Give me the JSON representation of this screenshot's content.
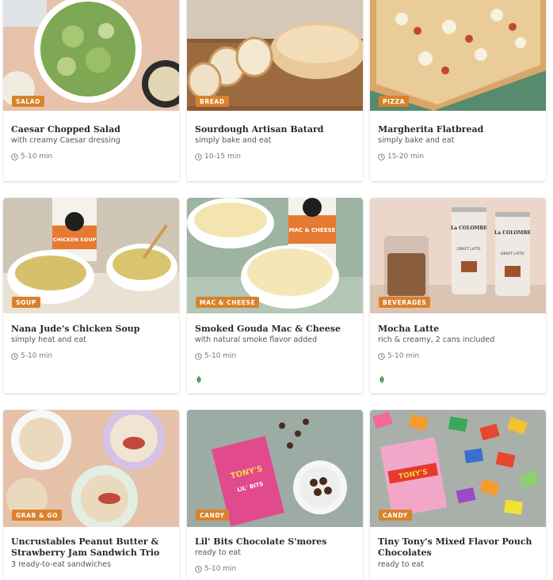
{
  "products": [
    {
      "category": "SALAD",
      "title": "Caesar Chopped Salad",
      "subtitle": "with creamy Caesar dressing",
      "time": "5-10 min"
    },
    {
      "category": "BREAD",
      "title": "Sourdough Artisan Batard",
      "subtitle": "simply bake and eat",
      "time": "10-15 min"
    },
    {
      "category": "PIZZA",
      "title": "Margherita Flatbread",
      "subtitle": "simply bake and eat",
      "time": "15-20 min"
    },
    {
      "category": "SOUP",
      "title": "Nana Jude's Chicken Soup",
      "subtitle": "simply heat and eat",
      "time": "5-10 min"
    },
    {
      "category": "MAC & CHEESE",
      "title": "Smoked Gouda Mac & Cheese",
      "subtitle": "with natural smoke flavor added",
      "time": "5-10 min"
    },
    {
      "category": "BEVERAGES",
      "title": "Mocha Latte",
      "subtitle": "rich & creamy, 2 cans included",
      "time": "5-10 min"
    },
    {
      "category": "GRAB & GO",
      "title": "Uncrustables Peanut Butter & Strawberry Jam Sandwich Trio",
      "subtitle": "3 ready-to-eat sandwiches"
    },
    {
      "category": "CANDY",
      "title": "Lil' Bits Chocolate S'mores",
      "subtitle": "ready to eat",
      "time": "5-10 min"
    },
    {
      "category": "CANDY",
      "title": "Tiny Tony's Mixed Flavor Pouch Chocolates",
      "subtitle": "ready to eat"
    }
  ],
  "images": {
    "salad": "Caesar chopped salad in white bowl",
    "tub_label_soup": "CHICKEN SOUP",
    "tub_label_mac": "MAC & CHEESE",
    "can_brand": "La COLOMBE",
    "can_label": "DRAFT LATTE",
    "bag_brand": "TONY'S",
    "bag_sub": "LIL' BITS",
    "bar_brand": "TONY'S"
  },
  "colors": {
    "badge": "#d9822b",
    "leaf": "#2e7d32"
  },
  "icons": {
    "time": "clock-icon",
    "vegetarian": "leaf-icon"
  }
}
